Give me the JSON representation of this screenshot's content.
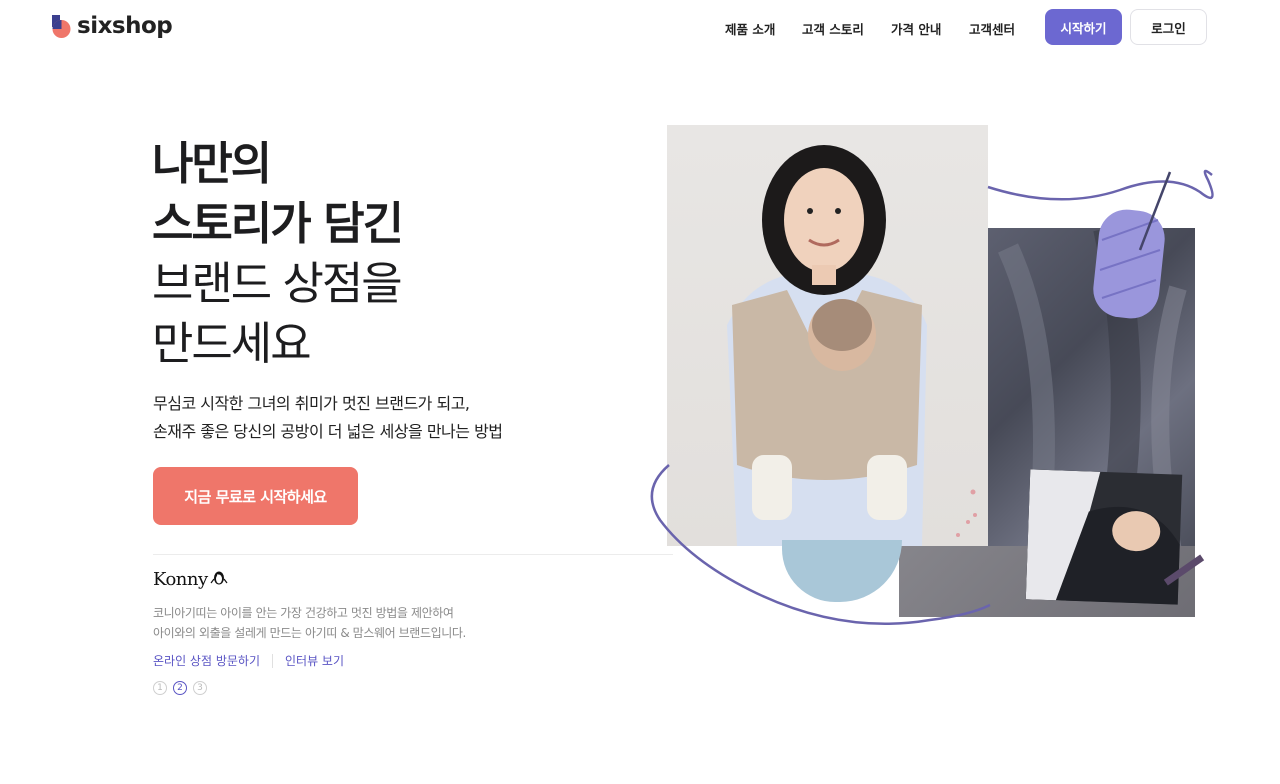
{
  "header": {
    "logo_text": "sixshop",
    "nav": [
      "제품 소개",
      "고객 스토리",
      "가격 안내",
      "고객센터"
    ],
    "start_label": "시작하기",
    "login_label": "로그인"
  },
  "hero": {
    "headline_bold": [
      "나만의",
      "스토리가 담긴"
    ],
    "headline_light": [
      "브랜드 상점을",
      "만드세요"
    ],
    "subcopy": [
      "무심코 시작한 그녀의 취미가 멋진 브랜드가 되고,",
      "손재주 좋은 당신의 공방이 더 넓은 세상을 만나는 방법"
    ],
    "cta_label": "지금 무료로 시작하세요"
  },
  "story": {
    "brand_name": "Konny",
    "description": [
      "코니아기띠는 아이를 안는 가장 건강하고 멋진 방법을 제안하여",
      "아이와의 외출을 설레게 만드는 아기띠 & 맘스웨어 브랜드입니다."
    ],
    "link_shop": "온라인 상점 방문하기",
    "link_interview": "인터뷰 보기",
    "pages": [
      "1",
      "2",
      "3"
    ],
    "active_page": 2
  },
  "colors": {
    "primary": "#6c68d1",
    "cta": "#ef766a",
    "link": "#5a55c4"
  }
}
